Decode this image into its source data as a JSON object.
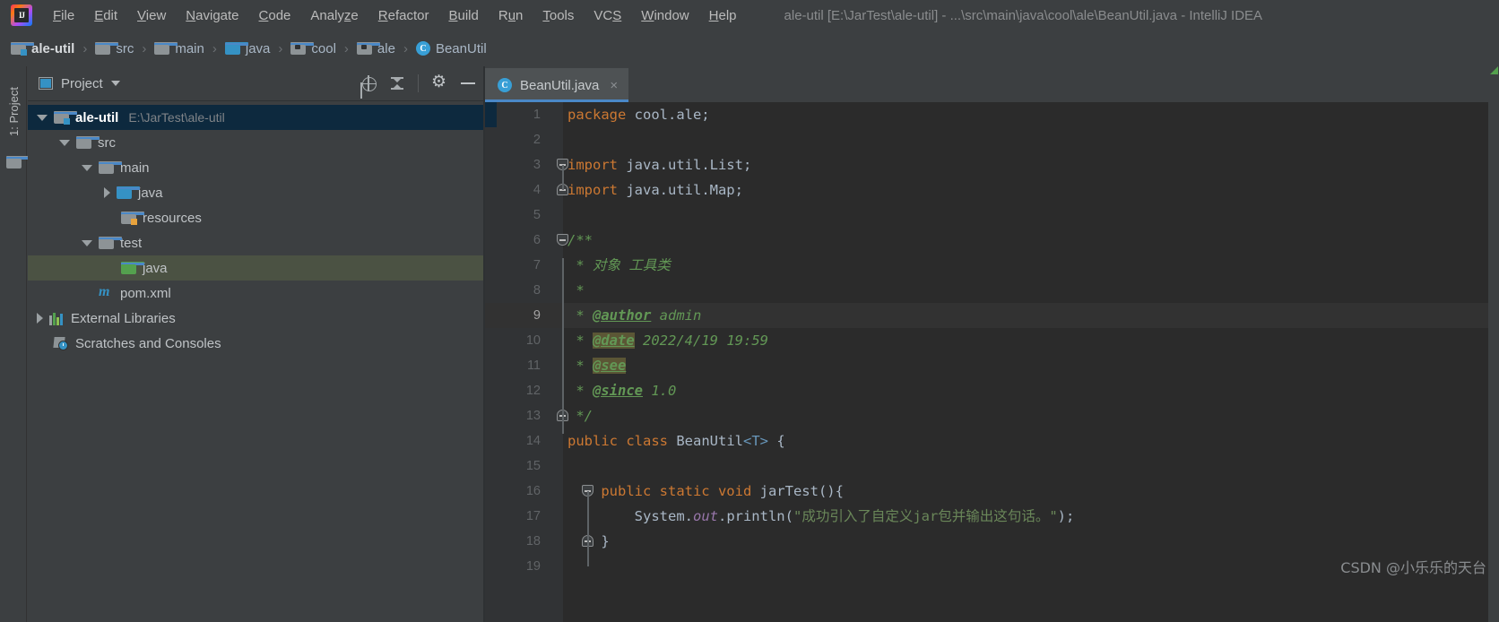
{
  "window": {
    "title": "ale-util [E:\\JarTest\\ale-util] - ...\\src\\main\\java\\cool\\ale\\BeanUtil.java - IntelliJ IDEA",
    "logo_text": "IJ"
  },
  "menu": {
    "items": [
      {
        "pre": "",
        "mn": "F",
        "post": "ile"
      },
      {
        "pre": "",
        "mn": "E",
        "post": "dit"
      },
      {
        "pre": "",
        "mn": "V",
        "post": "iew"
      },
      {
        "pre": "",
        "mn": "N",
        "post": "avigate"
      },
      {
        "pre": "",
        "mn": "C",
        "post": "ode"
      },
      {
        "pre": "Analy",
        "mn": "z",
        "post": "e"
      },
      {
        "pre": "",
        "mn": "R",
        "post": "efactor"
      },
      {
        "pre": "",
        "mn": "B",
        "post": "uild"
      },
      {
        "pre": "R",
        "mn": "u",
        "post": "n"
      },
      {
        "pre": "",
        "mn": "T",
        "post": "ools"
      },
      {
        "pre": "VC",
        "mn": "S",
        "post": ""
      },
      {
        "pre": "",
        "mn": "W",
        "post": "indow"
      },
      {
        "pre": "",
        "mn": "H",
        "post": "elp"
      }
    ]
  },
  "breadcrumb": {
    "items": [
      {
        "label": "ale-util",
        "icon": "module-folder-icon",
        "bold": true
      },
      {
        "label": "src",
        "icon": "folder-icon",
        "bold": false
      },
      {
        "label": "main",
        "icon": "folder-icon",
        "bold": false
      },
      {
        "label": "java",
        "icon": "source-folder-icon",
        "bold": false
      },
      {
        "label": "cool",
        "icon": "package-folder-icon",
        "bold": false
      },
      {
        "label": "ale",
        "icon": "package-folder-icon",
        "bold": false
      },
      {
        "label": "BeanUtil",
        "icon": "java-class-icon",
        "bold": false
      }
    ],
    "separator": "›"
  },
  "left_stripe": {
    "tab_label": "1: Project",
    "folder_icon": "folder-icon"
  },
  "project_panel": {
    "title": "Project",
    "tools": [
      {
        "name": "select-opened-file-icon",
        "label": "locate"
      },
      {
        "name": "collapse-all-icon",
        "label": "collapse"
      },
      {
        "name": "gear-icon",
        "label": "settings"
      },
      {
        "name": "hide-icon",
        "label": "hide"
      }
    ],
    "tree": [
      {
        "label": "ale-util",
        "path": "E:\\JarTest\\ale-util",
        "indent": 0,
        "arrow": "down",
        "icon": "module-folder-icon",
        "state": "selected-focus"
      },
      {
        "label": "src",
        "path": "",
        "indent": 1,
        "arrow": "down",
        "icon": "folder-icon",
        "state": ""
      },
      {
        "label": "main",
        "path": "",
        "indent": 2,
        "arrow": "down",
        "icon": "folder-icon",
        "state": ""
      },
      {
        "label": "java",
        "path": "",
        "indent": 3,
        "arrow": "right",
        "icon": "source-folder-icon",
        "state": ""
      },
      {
        "label": "resources",
        "path": "",
        "indent": 3,
        "arrow": "none",
        "icon": "resource-folder-icon",
        "state": ""
      },
      {
        "label": "test",
        "path": "",
        "indent": 2,
        "arrow": "down",
        "icon": "folder-icon",
        "state": ""
      },
      {
        "label": "java",
        "path": "",
        "indent": 3,
        "arrow": "none",
        "icon": "test-source-folder-icon",
        "state": "selected-green"
      },
      {
        "label": "pom.xml",
        "path": "",
        "indent": 2,
        "arrow": "none",
        "icon": "maven-file-icon",
        "state": ""
      },
      {
        "label": "External Libraries",
        "path": "",
        "indent": 0,
        "arrow": "right",
        "icon": "libraries-icon",
        "state": ""
      },
      {
        "label": "Scratches and Consoles",
        "path": "",
        "indent": 0,
        "arrow": "none",
        "icon": "scratches-icon",
        "state": ""
      }
    ]
  },
  "editor": {
    "tab": {
      "label": "BeanUtil.java",
      "icon": "java-class-icon",
      "close": "×"
    },
    "lines": [
      {
        "n": "1",
        "caret": false,
        "fold": "",
        "indent_guide": false,
        "tokens": [
          {
            "t": "package ",
            "c": "kw"
          },
          {
            "t": "cool.ale;",
            "c": "plain"
          }
        ]
      },
      {
        "n": "2",
        "caret": false,
        "fold": "",
        "indent_guide": false,
        "tokens": []
      },
      {
        "n": "3",
        "caret": false,
        "fold": "down",
        "indent_guide": false,
        "tokens": [
          {
            "t": "import ",
            "c": "kw"
          },
          {
            "t": "java.util.List;",
            "c": "plain"
          }
        ]
      },
      {
        "n": "4",
        "caret": false,
        "fold": "up",
        "indent_guide": false,
        "tokens": [
          {
            "t": "import ",
            "c": "kw"
          },
          {
            "t": "java.util.Map;",
            "c": "plain"
          }
        ]
      },
      {
        "n": "5",
        "caret": false,
        "fold": "",
        "indent_guide": false,
        "tokens": []
      },
      {
        "n": "6",
        "caret": false,
        "fold": "down",
        "indent_guide": false,
        "tokens": [
          {
            "t": "/**",
            "c": "cmt"
          }
        ]
      },
      {
        "n": "7",
        "caret": false,
        "fold": "",
        "indent_guide": false,
        "tokens": [
          {
            "t": " * 对象 工具类",
            "c": "cmt"
          }
        ]
      },
      {
        "n": "8",
        "caret": false,
        "fold": "",
        "indent_guide": false,
        "tokens": [
          {
            "t": " *",
            "c": "cmt"
          }
        ]
      },
      {
        "n": "9",
        "caret": true,
        "fold": "",
        "indent_guide": false,
        "tokens": [
          {
            "t": " * ",
            "c": "cmt"
          },
          {
            "t": "@author",
            "c": "tag"
          },
          {
            "t": " admin",
            "c": "cmt"
          }
        ]
      },
      {
        "n": "10",
        "caret": false,
        "fold": "",
        "indent_guide": false,
        "tokens": [
          {
            "t": " * ",
            "c": "cmt"
          },
          {
            "t": "@date",
            "c": "tag hl"
          },
          {
            "t": " 2022/4/19 19:59",
            "c": "cmt"
          }
        ]
      },
      {
        "n": "11",
        "caret": false,
        "fold": "",
        "indent_guide": false,
        "tokens": [
          {
            "t": " * ",
            "c": "cmt"
          },
          {
            "t": "@see",
            "c": "tag hl"
          }
        ]
      },
      {
        "n": "12",
        "caret": false,
        "fold": "",
        "indent_guide": false,
        "tokens": [
          {
            "t": " * ",
            "c": "cmt"
          },
          {
            "t": "@since",
            "c": "tag"
          },
          {
            "t": " 1.0",
            "c": "cmt"
          }
        ]
      },
      {
        "n": "13",
        "caret": false,
        "fold": "up",
        "indent_guide": false,
        "tokens": [
          {
            "t": " */",
            "c": "cmt"
          }
        ]
      },
      {
        "n": "14",
        "caret": false,
        "fold": "",
        "indent_guide": false,
        "tokens": [
          {
            "t": "public class ",
            "c": "kw"
          },
          {
            "t": "BeanUtil",
            "c": "plain"
          },
          {
            "t": "<T>",
            "c": "gen"
          },
          {
            "t": " {",
            "c": "plain"
          }
        ]
      },
      {
        "n": "15",
        "caret": false,
        "fold": "",
        "indent_guide": false,
        "tokens": []
      },
      {
        "n": "16",
        "caret": false,
        "fold": "down-ind",
        "indent_guide": false,
        "tokens": [
          {
            "t": "    public static void ",
            "c": "kw"
          },
          {
            "t": "jarTest",
            "c": "plain"
          },
          {
            "t": "(){",
            "c": "plain"
          }
        ]
      },
      {
        "n": "17",
        "caret": false,
        "fold": "",
        "indent_guide": true,
        "tokens": [
          {
            "t": "        System.",
            "c": "plain"
          },
          {
            "t": "out",
            "c": "fld"
          },
          {
            "t": ".println(",
            "c": "plain"
          },
          {
            "t": "\"成功引入了自定义jar包并输出这句话。\"",
            "c": "str"
          },
          {
            "t": ");",
            "c": "plain"
          }
        ]
      },
      {
        "n": "18",
        "caret": false,
        "fold": "up-ind",
        "indent_guide": false,
        "tokens": [
          {
            "t": "    }",
            "c": "plain"
          }
        ]
      },
      {
        "n": "19",
        "caret": false,
        "fold": "",
        "indent_guide": false,
        "tokens": []
      }
    ]
  },
  "watermark": {
    "text": "CSDN @小乐乐的天台"
  },
  "colors": {
    "accent": "#3592c4",
    "tab_underline": "#4a88c7",
    "selection_focus": "#0d293e",
    "selection_green": "#4b5243",
    "editor_bg": "#2b2b2b",
    "panel_bg": "#3c3f41",
    "keyword": "#cc7832",
    "string": "#6a8759",
    "comment": "#629755",
    "field": "#9876aa",
    "generic": "#6897bb",
    "tag_highlight": "#5b5635"
  }
}
